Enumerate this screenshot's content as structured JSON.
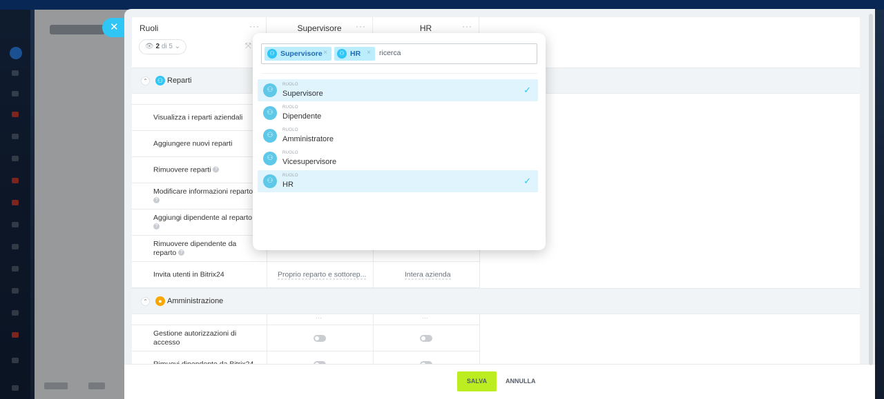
{
  "header": {
    "roles_title": "Ruoli",
    "col_supervisor": "Supervisore",
    "col_hr": "HR",
    "dots": "···",
    "counter_selected": "2",
    "counter_total": "di 5"
  },
  "sections": {
    "departments": "Reparti",
    "administration": "Amministrazione"
  },
  "rows_departments": [
    {
      "label": "Visualizza i reparti aziendali"
    },
    {
      "label": "Aggiungere nuovi reparti"
    },
    {
      "label": "Rimuovere reparti"
    },
    {
      "label": "Modificare informazioni reparto"
    },
    {
      "label": "Aggiungi dipendente al reparto"
    },
    {
      "label": "Rimuovere dipendente da reparto"
    },
    {
      "label": "Invita utenti in Bitrix24",
      "sup_value": "Proprio reparto e sottorep...",
      "hr_value": "Intera azienda"
    }
  ],
  "rows_admin": [
    {
      "label": "Gestione autorizzazioni di accesso"
    },
    {
      "label": "Rimuovi dipendente da Bitrix24"
    }
  ],
  "footer": {
    "save": "SALVA",
    "cancel": "ANNULLA"
  },
  "popup": {
    "tags": [
      {
        "label": "Supervisore"
      },
      {
        "label": "HR"
      }
    ],
    "search_placeholder": "ricerca",
    "caption": "RUOLO",
    "items": [
      {
        "name": "Supervisore",
        "selected": true
      },
      {
        "name": "Dipendente",
        "selected": false
      },
      {
        "name": "Amministratore",
        "selected": false
      },
      {
        "name": "Vicesupervisore",
        "selected": false
      },
      {
        "name": "HR",
        "selected": true
      }
    ]
  },
  "colors": {
    "accent": "#2fc6f6",
    "save_button": "#bbed21",
    "selected_row": "#dff4fc",
    "department_icon": "#2fc6f6",
    "admin_icon": "#f7a700"
  }
}
